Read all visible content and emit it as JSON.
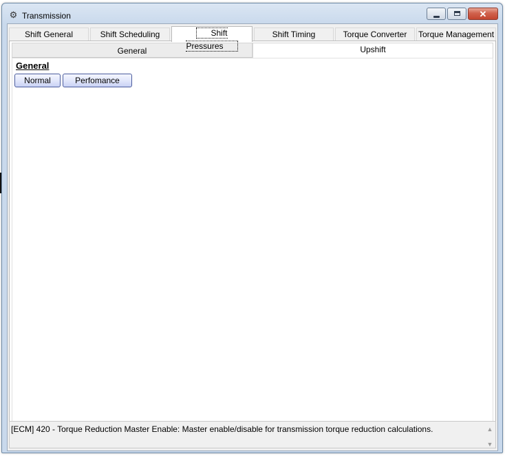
{
  "window": {
    "title": "Transmission",
    "icon": "gear-icon",
    "controls": {
      "minimize": "minimize-icon",
      "maximize": "maximize-icon",
      "close": "✕"
    }
  },
  "tabs": [
    {
      "label": "Shift General",
      "active": false
    },
    {
      "label": "Shift Scheduling",
      "active": false
    },
    {
      "label": "Shift Pressures",
      "active": true
    },
    {
      "label": "Shift Timing",
      "active": false
    },
    {
      "label": "Torque Converter",
      "active": false
    },
    {
      "label": "Torque Management",
      "active": false
    }
  ],
  "subtabs": [
    {
      "label": "General",
      "selected": false
    },
    {
      "label": "Upshift",
      "selected": true
    }
  ],
  "section": {
    "title": "General",
    "buttons": [
      "Normal",
      "Perfomance"
    ]
  },
  "description": {
    "text": "[ECM] 420 - Torque Reduction Master Enable: Master enable/disable for transmission torque reduction calculations.",
    "scroll_up": "▲",
    "scroll_down": "▼"
  },
  "colors": {
    "title_gradient_top": "#dbe6f3",
    "close_button": "#c3452f",
    "mode_button_border": "#4a5b9c"
  }
}
